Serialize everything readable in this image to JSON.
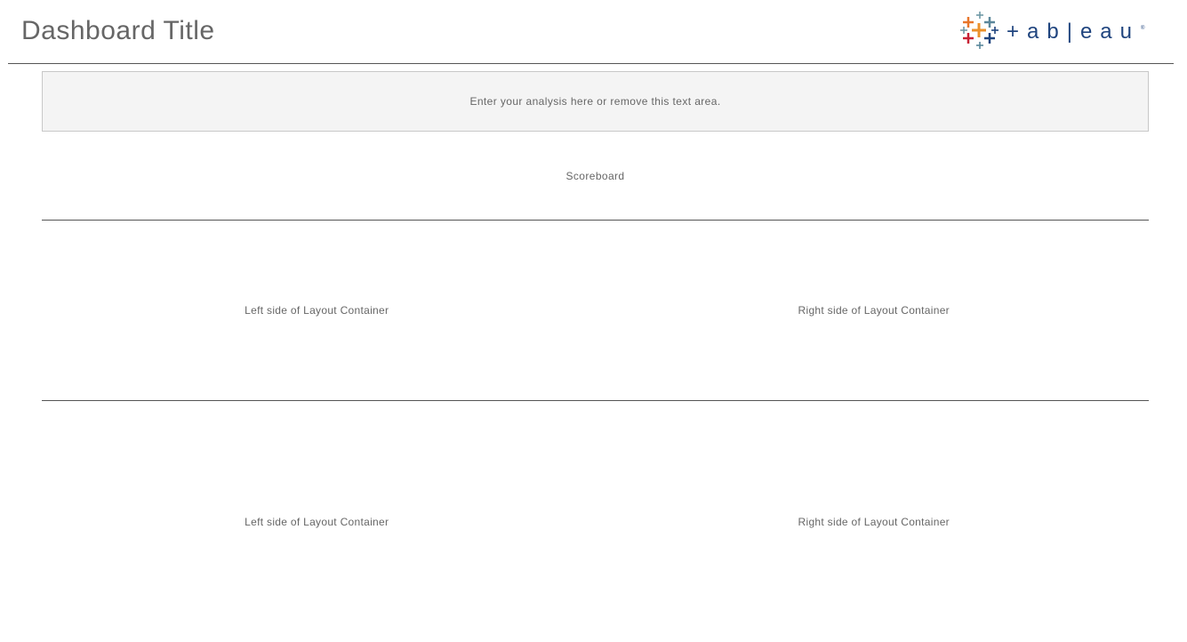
{
  "header": {
    "title": "Dashboard Title",
    "logo_name": "tableau-logo",
    "logo_wordmark": "+ableau",
    "rule_color": "#555555"
  },
  "analysis": {
    "text": "Enter your analysis here or remove this text area."
  },
  "scoreboard": {
    "label": "Scoreboard"
  },
  "rows": [
    {
      "left": "Left side of Layout Container",
      "right": "Right side of Layout Container"
    },
    {
      "left": "Left side of Layout Container",
      "right": "Right side of Layout Container"
    }
  ],
  "colors": {
    "logo_orange": "#e8762b",
    "logo_blue": "#5b879b",
    "logo_navy": "#1f447e",
    "logo_red": "#c72035",
    "logo_teal": "#59879b",
    "logo_yellow": "#eb912b",
    "logo_gray": "#7099a6",
    "analysis_bg": "#f4f4f4"
  }
}
